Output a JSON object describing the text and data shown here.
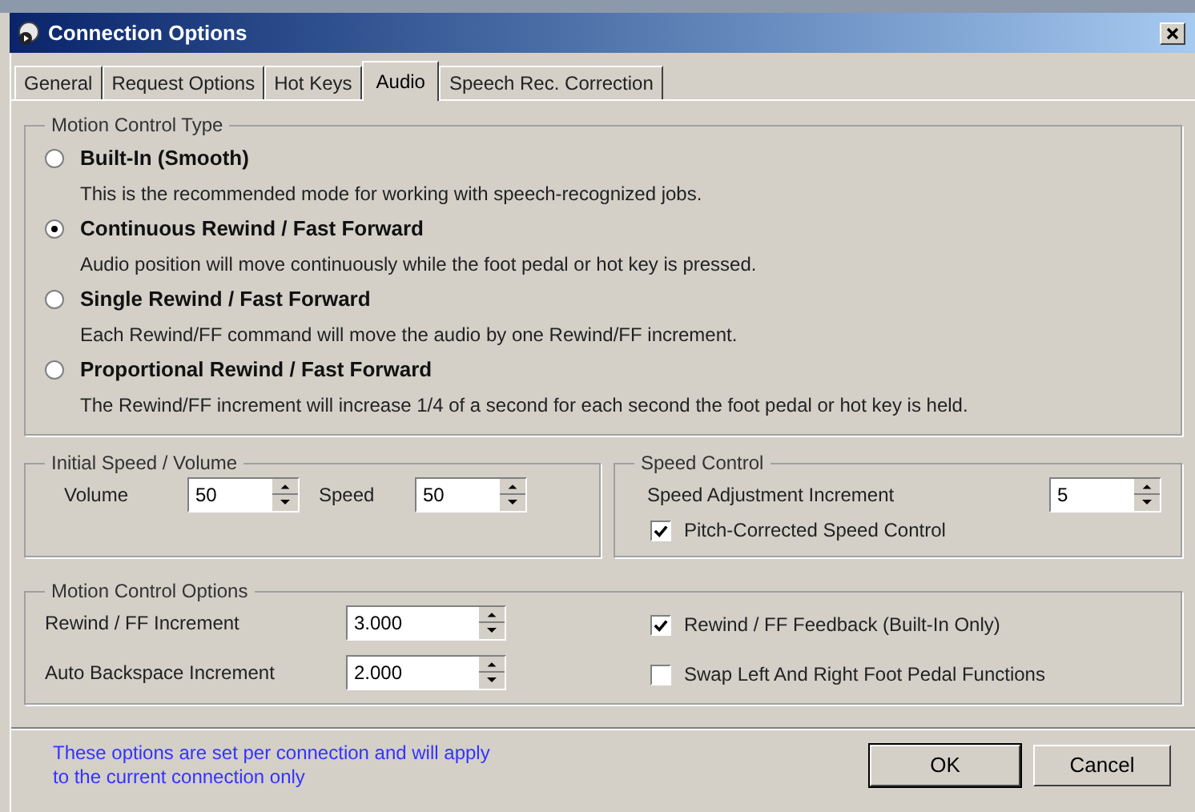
{
  "window": {
    "title": "Connection Options"
  },
  "tabs": [
    {
      "label": "General",
      "selected": false
    },
    {
      "label": "Request Options",
      "selected": false
    },
    {
      "label": "Hot Keys",
      "selected": false
    },
    {
      "label": "Audio",
      "selected": true
    },
    {
      "label": "Speech Rec. Correction",
      "selected": false
    }
  ],
  "motion_control_type": {
    "title": "Motion Control Type",
    "options": [
      {
        "label": "Built-In (Smooth)",
        "description": "This is the recommended mode for working with speech-recognized jobs.",
        "selected": false
      },
      {
        "label": "Continuous Rewind / Fast Forward",
        "description": "Audio position will move continuously while the foot pedal or hot key is pressed.",
        "selected": true
      },
      {
        "label": "Single Rewind / Fast Forward",
        "description": "Each Rewind/FF command will move the audio by one Rewind/FF increment.",
        "selected": false
      },
      {
        "label": "Proportional Rewind / Fast Forward",
        "description": "The Rewind/FF increment will increase 1/4 of a second for each second the foot pedal or hot key is held.",
        "selected": false
      }
    ]
  },
  "initial_speed_volume": {
    "title": "Initial Speed / Volume",
    "fields": [
      {
        "label": "Volume",
        "value": "50"
      },
      {
        "label": "Speed",
        "value": "50"
      }
    ]
  },
  "speed_control": {
    "title": "Speed Control",
    "field": {
      "label": "Speed Adjustment Increment",
      "value": "5"
    },
    "checkbox": {
      "label": "Pitch-Corrected Speed Control",
      "checked": true
    }
  },
  "motion_control_options": {
    "title": "Motion Control Options",
    "fields": [
      {
        "label": "Rewind / FF Increment",
        "value": "3.000"
      },
      {
        "label": "Auto Backspace Increment",
        "value": "2.000"
      }
    ],
    "checkboxes": [
      {
        "label": "Rewind / FF Feedback (Built-In Only)",
        "checked": true
      },
      {
        "label": "Swap Left And Right Foot Pedal Functions",
        "checked": false
      }
    ]
  },
  "footer": {
    "note": "These options are set per connection and will apply to the current connection only",
    "buttons": [
      "OK",
      "Cancel"
    ]
  }
}
